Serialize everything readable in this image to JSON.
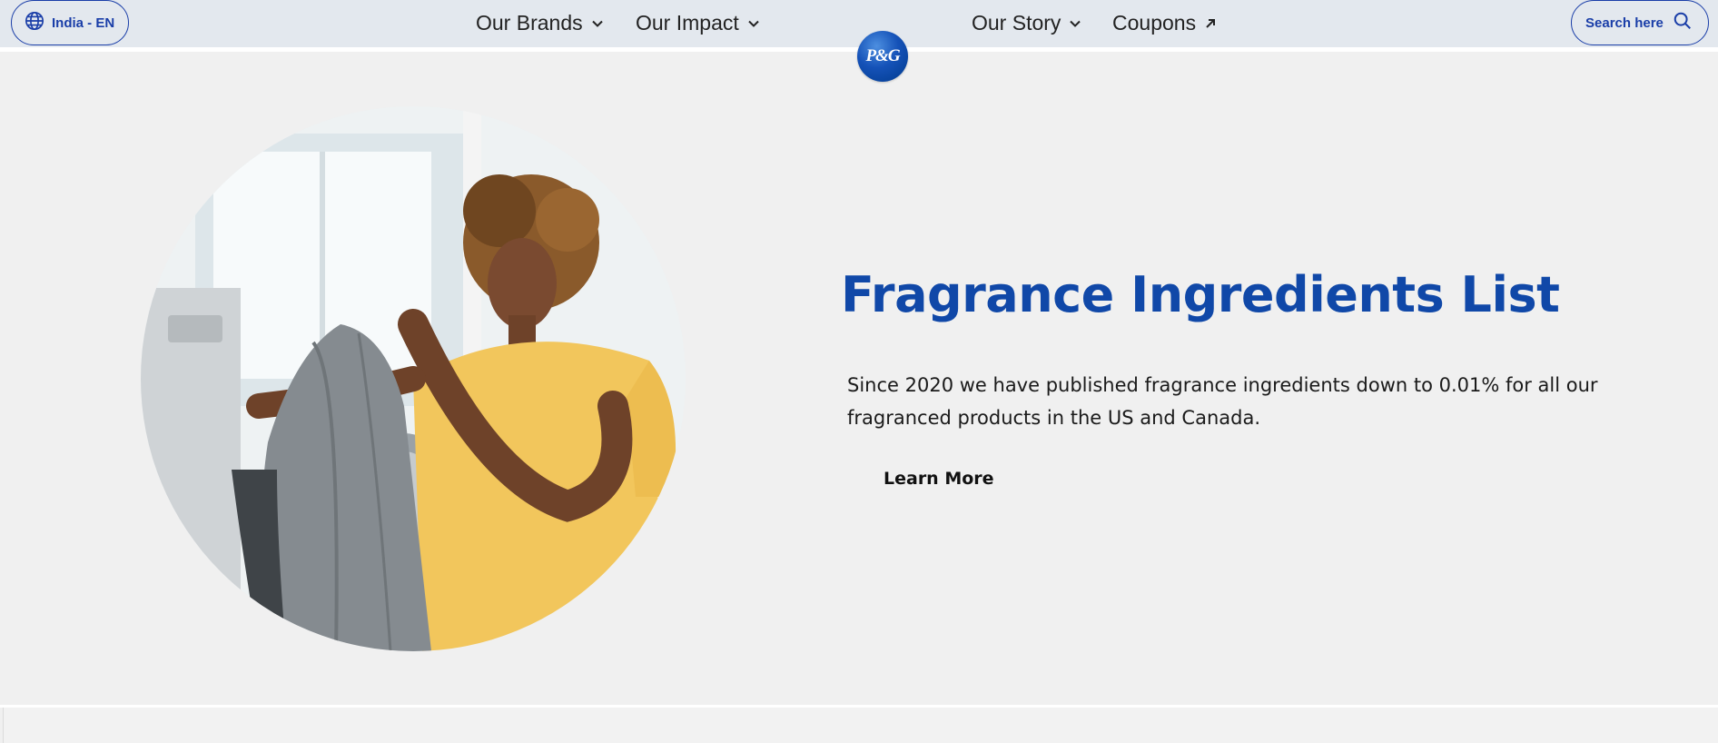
{
  "header": {
    "language_label": "India - EN",
    "language_icon": "globe-icon",
    "nav": [
      {
        "label": "Our Brands",
        "icon": "chevron-down-icon"
      },
      {
        "label": "Our Impact",
        "icon": "chevron-down-icon"
      },
      {
        "label": "Our Story",
        "icon": "chevron-down-icon"
      },
      {
        "label": "Coupons",
        "icon": "arrow-up-right-icon"
      }
    ],
    "logo_text": "P&G",
    "search_label": "Search here",
    "search_icon": "search-icon"
  },
  "hero": {
    "title": "Fragrance Ingredients List",
    "description": "Since 2020 we have published fragrance ingredients down to 0.01% for all our fragranced products in the US and Canada.",
    "cta_label": "Learn More"
  },
  "colors": {
    "brand_blue": "#1048a8",
    "header_bg": "#e3e8ee",
    "page_bg": "#f0f0f0"
  }
}
